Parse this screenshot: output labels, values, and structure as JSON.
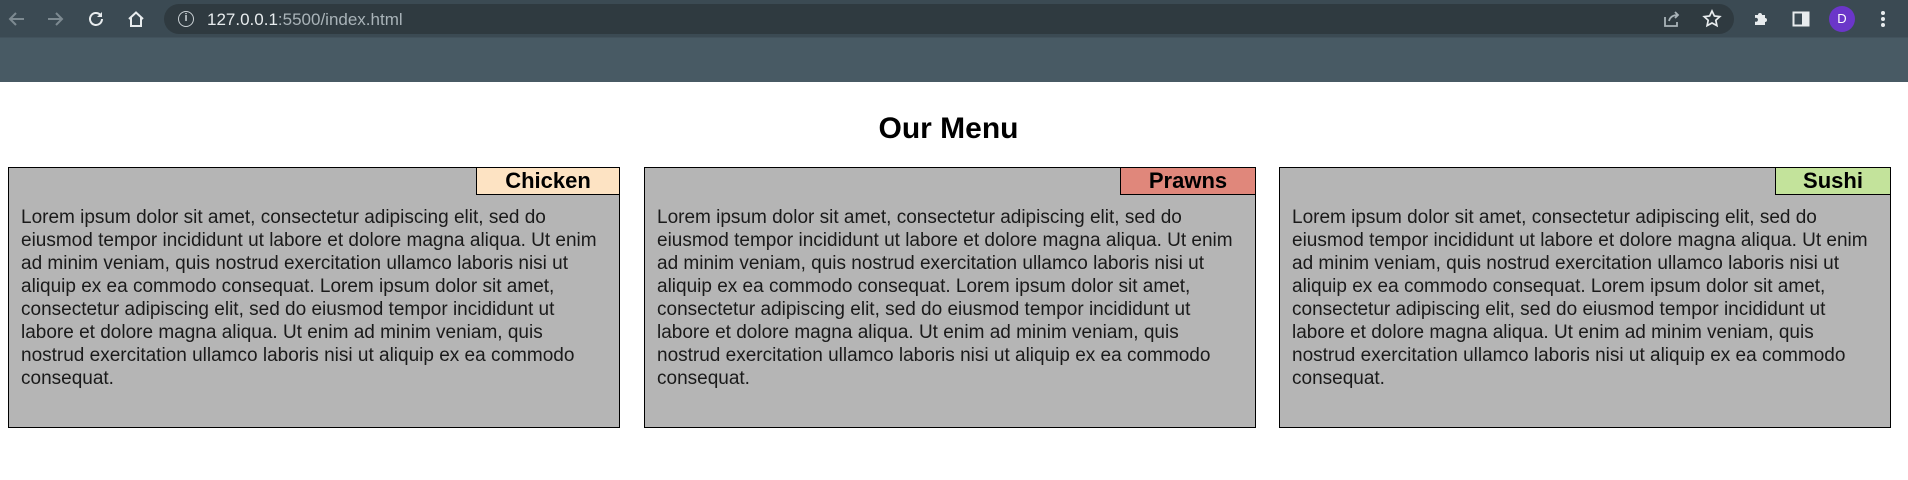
{
  "browser": {
    "url_host": "127.0.0.1",
    "url_rest": ":5500/index.html",
    "profile_initial": "D",
    "icons": {
      "back": "back-arrow-icon",
      "forward": "forward-arrow-icon",
      "reload": "reload-icon",
      "home": "home-icon",
      "site_info": "info-icon",
      "share": "share-icon",
      "bookmark": "star-icon",
      "extensions": "puzzle-icon",
      "side_panel": "side-panel-icon",
      "menu": "kebab-menu-icon"
    },
    "colors": {
      "chrome_top": "#3b4a53",
      "chrome_bar": "#485a64",
      "avatar": "#6b36c9"
    }
  },
  "page": {
    "title": "Our Menu",
    "cards": [
      {
        "tag": "Chicken",
        "tag_color": "#fde3c3",
        "text": "Lorem ipsum dolor sit amet, consectetur adipiscing elit, sed do eiusmod tempor incididunt ut labore et dolore magna aliqua. Ut enim ad minim veniam, quis nostrud exercitation ullamco laboris nisi ut aliquip ex ea commodo consequat. Lorem ipsum dolor sit amet, consectetur adipiscing elit, sed do eiusmod tempor incididunt ut labore et dolore magna aliqua. Ut enim ad minim veniam, quis nostrud exercitation ullamco laboris nisi ut aliquip ex ea commodo consequat."
      },
      {
        "tag": "Prawns",
        "tag_color": "#e0877b",
        "text": "Lorem ipsum dolor sit amet, consectetur adipiscing elit, sed do eiusmod tempor incididunt ut labore et dolore magna aliqua. Ut enim ad minim veniam, quis nostrud exercitation ullamco laboris nisi ut aliquip ex ea commodo consequat. Lorem ipsum dolor sit amet, consectetur adipiscing elit, sed do eiusmod tempor incididunt ut labore et dolore magna aliqua. Ut enim ad minim veniam, quis nostrud exercitation ullamco laboris nisi ut aliquip ex ea commodo consequat."
      },
      {
        "tag": "Sushi",
        "tag_color": "#c3e39b",
        "text": "Lorem ipsum dolor sit amet, consectetur adipiscing elit, sed do eiusmod tempor incididunt ut labore et dolore magna aliqua. Ut enim ad minim veniam, quis nostrud exercitation ullamco laboris nisi ut aliquip ex ea commodo consequat. Lorem ipsum dolor sit amet, consectetur adipiscing elit, sed do eiusmod tempor incididunt ut labore et dolore magna aliqua. Ut enim ad minim veniam, quis nostrud exercitation ullamco laboris nisi ut aliquip ex ea commodo consequat."
      }
    ]
  }
}
